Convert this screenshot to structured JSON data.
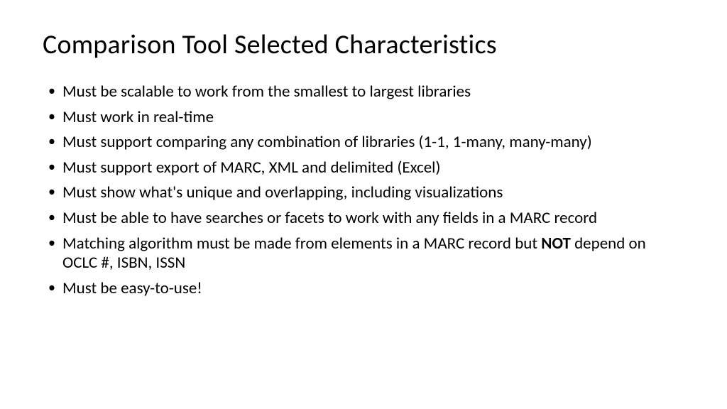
{
  "slide": {
    "title": "Comparison Tool Selected Characteristics",
    "bullets": [
      {
        "text": "Must be scalable to work from the smallest to largest libraries"
      },
      {
        "text": "Must work in real-time"
      },
      {
        "text": "Must support comparing any combination of libraries (1-1, 1-many, many-many)"
      },
      {
        "text": "Must support export of MARC, XML and delimited (Excel)"
      },
      {
        "text": "Must show what's unique and overlapping, including visualizations"
      },
      {
        "text": "Must be able to have searches or facets to work with any fields in a MARC record"
      },
      {
        "prefix": "Matching algorithm must be made from elements in a MARC record but ",
        "bold": "NOT",
        "suffix": " depend on OCLC #, ISBN, ISSN"
      },
      {
        "text": "Must be easy-to-use!"
      }
    ]
  }
}
